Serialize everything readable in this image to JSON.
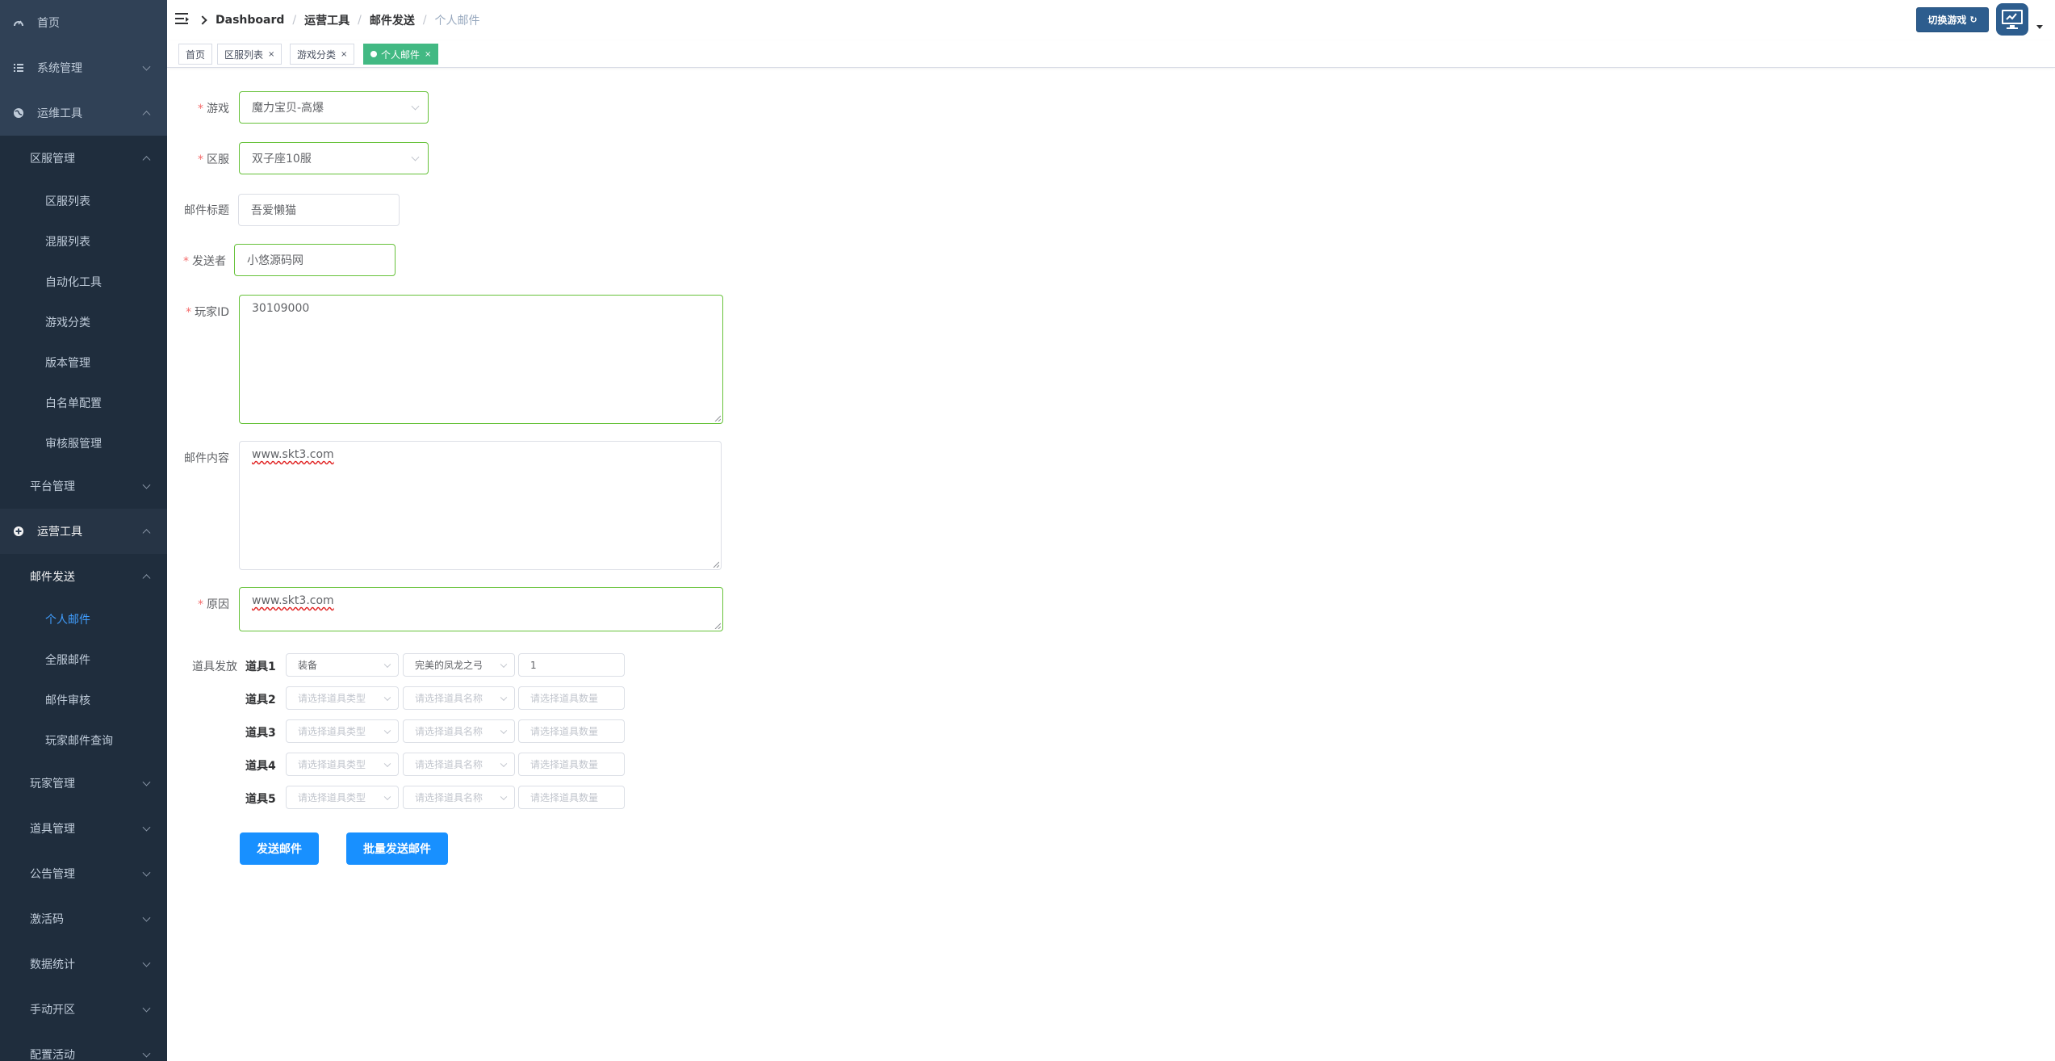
{
  "sidebar": {
    "items": [
      {
        "label": "首页",
        "icon": "dashboard-icon"
      },
      {
        "label": "系统管理",
        "icon": "list-icon"
      },
      {
        "label": "运维工具",
        "icon": "globe-icon"
      },
      {
        "label": "区服管理"
      },
      {
        "label": "区服列表"
      },
      {
        "label": "混服列表"
      },
      {
        "label": "自动化工具"
      },
      {
        "label": "游戏分类"
      },
      {
        "label": "版本管理"
      },
      {
        "label": "白名单配置"
      },
      {
        "label": "审核服管理"
      },
      {
        "label": "平台管理"
      },
      {
        "label": "运营工具",
        "icon": "plus-circle-icon"
      },
      {
        "label": "邮件发送"
      },
      {
        "label": "个人邮件"
      },
      {
        "label": "全服邮件"
      },
      {
        "label": "邮件审核"
      },
      {
        "label": "玩家邮件查询"
      },
      {
        "label": "玩家管理"
      },
      {
        "label": "道具管理"
      },
      {
        "label": "公告管理"
      },
      {
        "label": "激活码"
      },
      {
        "label": "数据统计"
      },
      {
        "label": "手动开区"
      },
      {
        "label": "配置活动"
      }
    ]
  },
  "navbar": {
    "breadcrumb": [
      "Dashboard",
      "运营工具",
      "邮件发送",
      "个人邮件"
    ],
    "switch_label": "切换游戏",
    "accent": "#2d5d8e"
  },
  "tags": [
    "首页",
    "区服列表",
    "游戏分类",
    "个人邮件"
  ],
  "form": {
    "game_label": "游戏",
    "game_value": "魔力宝贝-高爆",
    "server_label": "区服",
    "server_value": "双子座10服",
    "title_label": "邮件标题",
    "title_value": "吾爱懒猫",
    "sender_label": "发送者",
    "sender_value": "小悠源码网",
    "player_label": "玩家ID",
    "player_value": "30109000",
    "content_label": "邮件内容",
    "content_value": "www.skt3.com",
    "reason_label": "原因",
    "reason_value": "www.skt3.com",
    "items_label": "道具发放",
    "items": [
      {
        "label": "道具1",
        "type": "装备",
        "name": "完美的凤龙之弓",
        "qty": "1"
      },
      {
        "label": "道具2",
        "type": "",
        "name": "",
        "qty": ""
      },
      {
        "label": "道具3",
        "type": "",
        "name": "",
        "qty": ""
      },
      {
        "label": "道具4",
        "type": "",
        "name": "",
        "qty": ""
      },
      {
        "label": "道具5",
        "type": "",
        "name": "",
        "qty": ""
      }
    ],
    "type_placeholder": "请选择道具类型",
    "name_placeholder": "请选择道具名称",
    "qty_placeholder": "请选择道具数量",
    "send_label": "发送邮件",
    "batch_label": "批量发送邮件"
  }
}
